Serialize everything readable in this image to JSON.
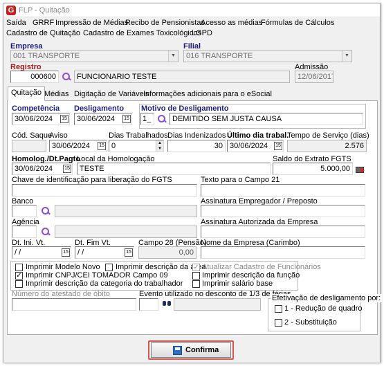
{
  "window": {
    "title": "FLP - Quitação"
  },
  "menu": {
    "row1": [
      "Saída",
      "GRRF",
      "Impressão de Médias",
      "Recibo de Pensionistas",
      "Acesso as médias",
      "Fórmulas de Cálculos"
    ],
    "row2": [
      "Cadastro de Quitação",
      "Cadastro de Exames Toxicológicos",
      "LGPD"
    ]
  },
  "header": {
    "empresa_label": "Empresa",
    "empresa_value": "001 TRANSPORTE",
    "filial_label": "Filial",
    "filial_value": "016 TRANSPORTE",
    "registro_label": "Registro",
    "registro_value": "000600",
    "funcionario_name": "FUNCIONARIO TESTE",
    "admissao_label": "Admissão",
    "admissao_value": "12/06/2017"
  },
  "tabs": [
    "Quitação",
    "Médias",
    "Digitação de Variáveis",
    "Informações adicionais para o eSocial"
  ],
  "form": {
    "competencia_label": "Competência",
    "competencia_value": "30/06/2024",
    "desligamento_label": "Desligamento",
    "desligamento_value": "30/06/2024",
    "motivo_label": "Motivo de Desligamento",
    "motivo_code": "1_",
    "motivo_desc": "DEMITIDO SEM JUSTA CAUSA",
    "cod_saque_label": "Cód. Saque",
    "aviso_label": "Aviso",
    "aviso_value": "30/06/2024",
    "dias_trabalhados_label": "Dias Trabalhados",
    "dias_trabalhados_value": "0",
    "dias_indenizados_label": "Dias Indenizados",
    "dias_indenizados_value": "30",
    "ultimo_dia_label": "Último dia trabal.",
    "ultimo_dia_value": "30/06/2024",
    "tempo_servico_label": "Tempo de Serviço (dias)",
    "tempo_servico_value": "2.576",
    "homolog_label": "Homolog./Dt.Pagto",
    "homolog_value": "30/06/2024",
    "local_homolog_label": "Local da Homologação",
    "local_homolog_value": "TESTE",
    "saldo_fgts_label": "Saldo do Extrato FGTS",
    "saldo_fgts_value": "5.000,00",
    "chave_fgts_label": "Chave de identificação para liberação do FGTS",
    "texto_campo21_label": "Texto para o Campo 21",
    "banco_label": "Banco",
    "assinatura_empregador_label": "Assinatura Empregador / Preposto",
    "agencia_label": "Agência",
    "assinatura_autorizada_label": "Assinatura Autorizada da Empresa",
    "dt_ini_label": "Dt. Ini. Vt.",
    "dt_ini_value": " / /",
    "dt_fim_label": "Dt. Fim Vt.",
    "dt_fim_value": " / /",
    "campo28_label": "Campo 28 (Pensão)",
    "campo28_value": "0,00",
    "nome_empresa_label": "Nome da Empresa (Carimbo)",
    "opt_modelo_novo": "Imprimir Modelo Novo",
    "opt_desc_area": "Imprimir descrição da área",
    "opt_atualizar": "Atualizar Cadastro de Funcionários",
    "opt_cnpj": "Imprimir CNPJ/CEI TOMADOR Campo 09",
    "opt_desc_funcao": "Imprimir descrição da função",
    "opt_desc_categoria": "Imprimir descrição da categoria do trabalhador",
    "opt_salario_base": "Imprimir salário base",
    "numero_atestado_label": "Número do atestado de óbito",
    "evento_label": "Evento utilizado no desconto de 1/3 de férias",
    "efetivacao_label": "Efetivação de desligamento por:",
    "efetivacao_opt1": "1 - Redução de quadro",
    "efetivacao_opt2": "2 - Substituição"
  },
  "footer": {
    "confirm_label": "Confirma"
  },
  "colors": {
    "accent_red": "#d9534f",
    "label_blue": "#1c1c7a",
    "search_purple": "#8b4fd6"
  }
}
